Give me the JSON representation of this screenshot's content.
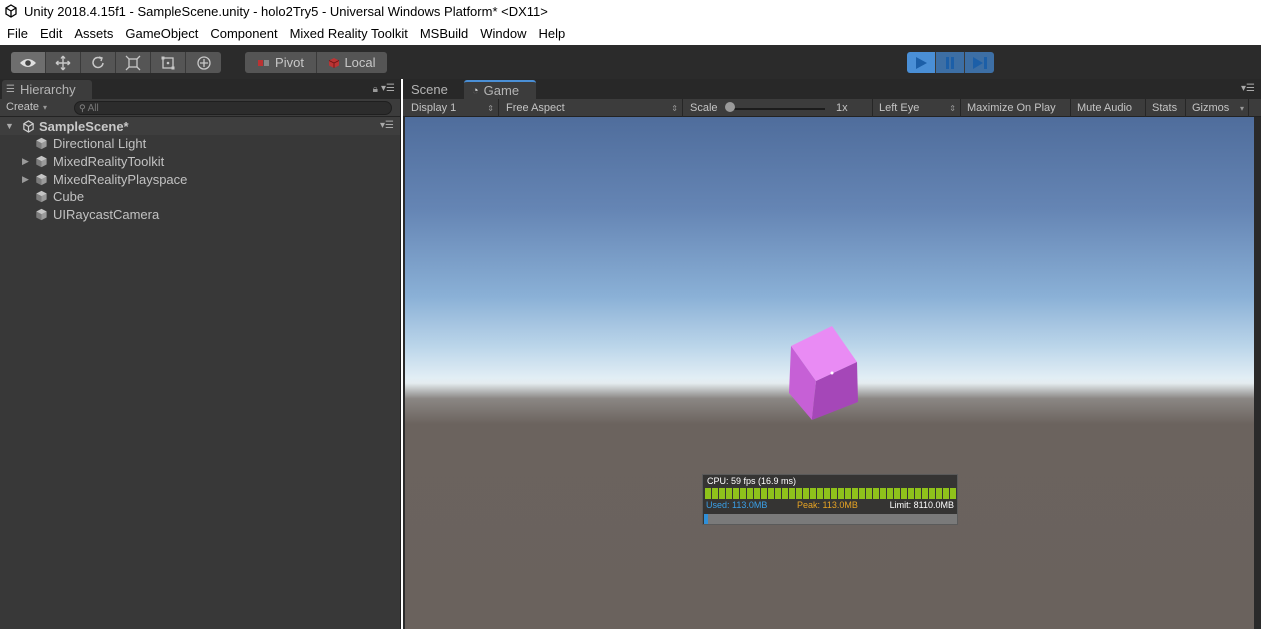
{
  "window": {
    "title": "Unity 2018.4.15f1 - SampleScene.unity - holo2Try5 - Universal Windows Platform* <DX11>"
  },
  "menu": [
    "File",
    "Edit",
    "Assets",
    "GameObject",
    "Component",
    "Mixed Reality Toolkit",
    "MSBuild",
    "Window",
    "Help"
  ],
  "toolbar": {
    "tools": [
      "view-tool-icon",
      "move-tool-icon",
      "rotate-tool-icon",
      "scale-tool-icon",
      "rect-tool-icon",
      "transform-tool-icon"
    ],
    "active_tool": "view-tool-icon",
    "pivot_label": "Pivot",
    "local_label": "Local",
    "play_active": true
  },
  "hierarchy": {
    "tab_label": "Hierarchy",
    "create_label": "Create",
    "search_placeholder": "All",
    "scene_name": "SampleScene*",
    "items": [
      {
        "label": "Directional Light",
        "expandable": false
      },
      {
        "label": "MixedRealityToolkit",
        "expandable": true
      },
      {
        "label": "MixedRealityPlayspace",
        "expandable": true
      },
      {
        "label": "Cube",
        "expandable": false
      },
      {
        "label": "UIRaycastCamera",
        "expandable": false
      }
    ]
  },
  "game": {
    "tabs": {
      "scene": "Scene",
      "game": "Game"
    },
    "active_tab": "Game",
    "display": "Display 1",
    "aspect": "Free Aspect",
    "scale_label": "Scale",
    "scale_value": "1x",
    "eye": "Left Eye",
    "maximize_on_play": "Maximize On Play",
    "mute_audio": "Mute Audio",
    "stats": "Stats",
    "gizmos": "Gizmos",
    "scale_level": 0
  },
  "profiler": {
    "cpu": "CPU: 59 fps (16.9 ms)",
    "used": "Used: 113.0MB",
    "peak": "Peak: 113.0MB",
    "limit": "Limit: 8110.0MB",
    "used_fraction": 0.014,
    "bar_color": "#8fc21b",
    "used_color": "#3aa0e8",
    "peak_color": "#e8a423"
  },
  "colors": {
    "cube": "#d46fe6",
    "play_active": "#4a8fd6"
  }
}
